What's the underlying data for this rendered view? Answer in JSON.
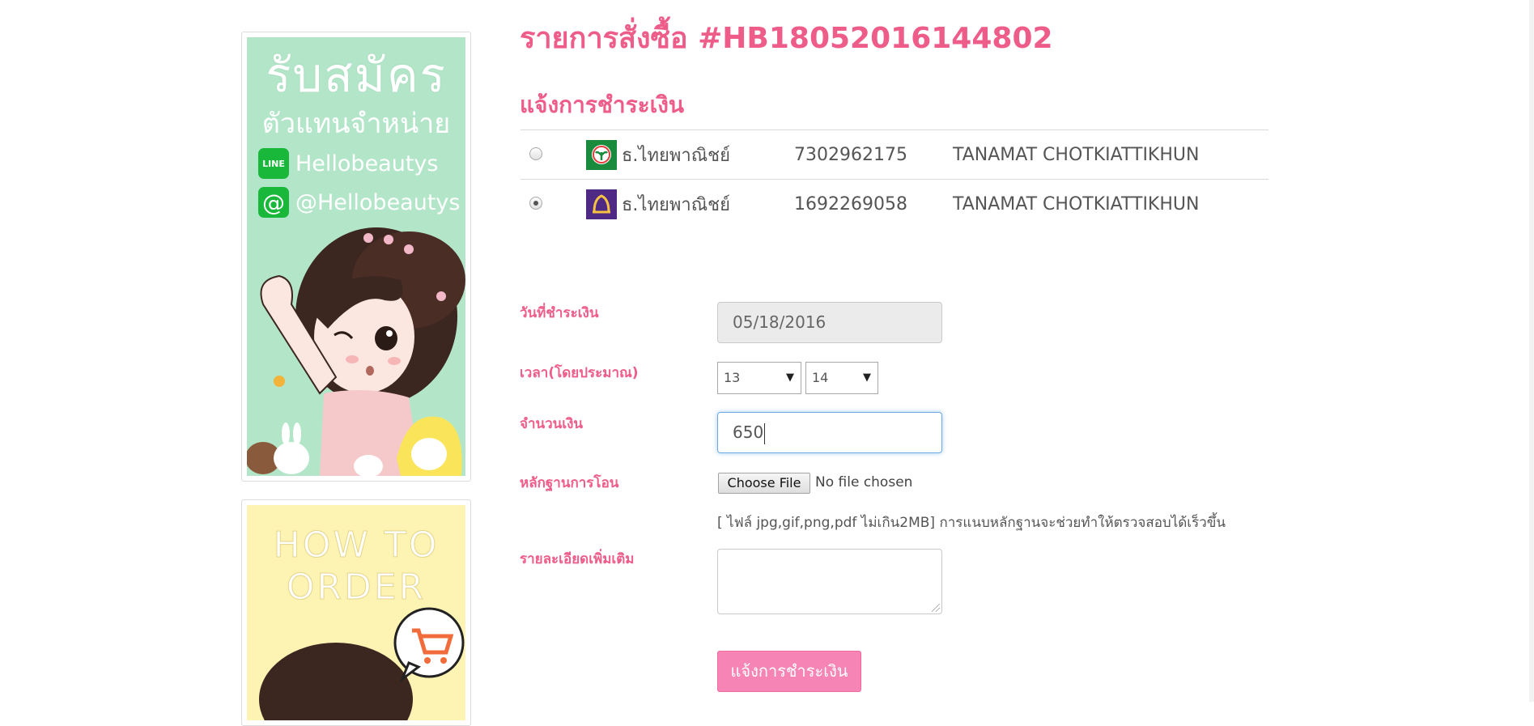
{
  "sidebar": {
    "recruit_banner": {
      "title": "รับสมัคร",
      "subtitle": "ตัวแทนจำหน่าย",
      "line_badge": "LINE",
      "line_id": "Hellobeautys",
      "at_badge": "@",
      "at_id": "@Hellobeautys"
    },
    "howto_banner": {
      "title_line1": "HOW TO",
      "title_line2": "ORDER"
    }
  },
  "order": {
    "title": "รายการสั่งซื้อ #HB18052016144802"
  },
  "payment": {
    "section_title": "แจ้งการชำระเงิน",
    "banks": [
      {
        "selected": false,
        "bank_name": "ธ.ไทยพาณิชย์",
        "account_number": "7302962175",
        "account_name": "TANAMAT CHOTKIATTIKHUN",
        "logo_color": "#1a8a3c"
      },
      {
        "selected": true,
        "bank_name": "ธ.ไทยพาณิชย์",
        "account_number": "1692269058",
        "account_name": "TANAMAT CHOTKIATTIKHUN",
        "logo_color": "#4e2a84"
      }
    ]
  },
  "form": {
    "date_label": "วันที่ชำระเงิน",
    "date_value": "05/18/2016",
    "time_label": "เวลา(โดยประมาณ)",
    "hour_value": "13",
    "minute_value": "14",
    "amount_label": "จำนวนเงิน",
    "amount_value": "650",
    "proof_label": "หลักฐานการโอน",
    "file_button": "Choose File",
    "file_status": "No file chosen",
    "file_hint": "[ ไฟล์ jpg,gif,png,pdf ไม่เกิน2MB] การแนบหลักฐานจะช่วยทำให้ตรวจสอบได้เร็วขึ้น",
    "detail_label": "รายละเอียดเพิ่มเติม",
    "detail_value": "",
    "submit_label": "แจ้งการชำระเงิน"
  },
  "colors": {
    "accent_pink": "#ee5d8a",
    "button_pink": "#f684b4",
    "banner_green": "#b3e6c9",
    "banner_yellow": "#fdf3b3"
  }
}
